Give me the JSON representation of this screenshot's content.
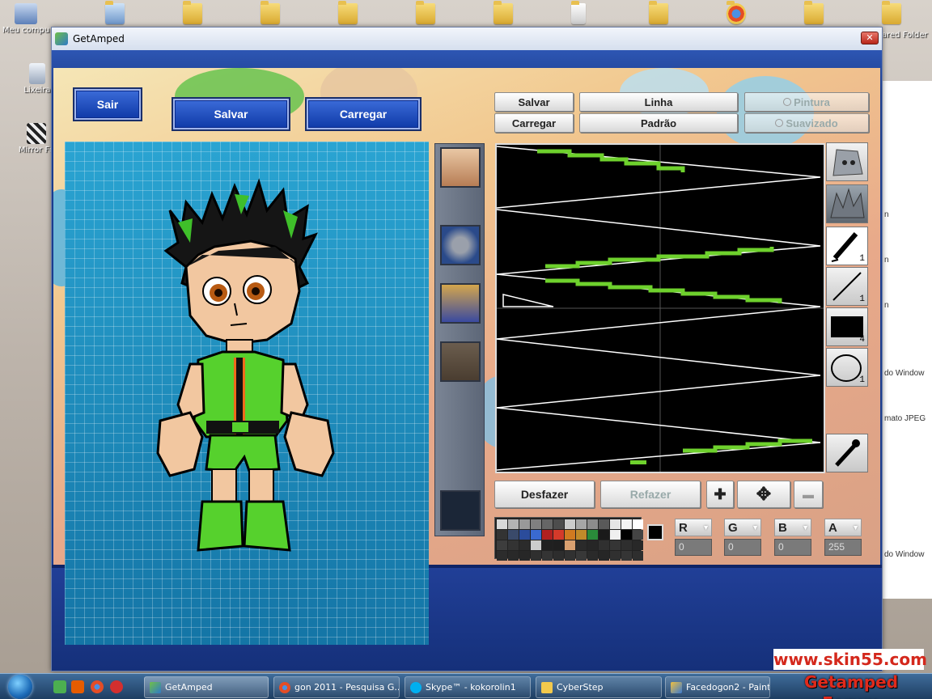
{
  "desktop": {
    "icons": [
      {
        "label": "Meu compu"
      },
      {
        "label": "Lixeira"
      },
      {
        "label": "Mirror Fo"
      }
    ],
    "right_label": "ared Folder"
  },
  "background_window": {
    "lines": [
      "n",
      "n",
      "n",
      "do Window",
      "mato JPEG",
      "do Window"
    ]
  },
  "window": {
    "title": "GetAmped",
    "close_glyph": "✕"
  },
  "menu": {
    "exit_label": "Sair",
    "save_label": "Salvar",
    "load_label": "Carregar"
  },
  "editor": {
    "save_label": "Salvar",
    "load_label": "Carregar",
    "line_label": "Linha",
    "default_label": "Padrão",
    "paint_label": "Pintura",
    "smooth_label": "Suavizado",
    "undo_label": "Desfazer",
    "redo_label": "Refazer"
  },
  "tools": [
    {
      "icon": "skull-icon",
      "count": ""
    },
    {
      "icon": "spiky-hair-icon",
      "count": ""
    },
    {
      "icon": "pen-icon",
      "count": "1"
    },
    {
      "icon": "line-icon",
      "count": "1"
    },
    {
      "icon": "rectangle-icon",
      "count": "4"
    },
    {
      "icon": "ellipse-icon",
      "count": "1"
    },
    {
      "icon": "eyedropper-icon",
      "count": ""
    }
  ],
  "palette": [
    "#d9d9d9",
    "#b3b3b3",
    "#999999",
    "#808080",
    "#666666",
    "#4d4d4d",
    "#cccccc",
    "#a6a6a6",
    "#8c8c8c",
    "#595959",
    "#e6e6e6",
    "#f2f2f2",
    "#ffffff",
    "#333333",
    "#3a4a6a",
    "#2b4c9b",
    "#3a6ad0",
    "#b02020",
    "#d43a2a",
    "#d07a20",
    "#c08a2a",
    "#2a8a3a",
    "#1a1a1a",
    "#f0f0f0",
    "#000000",
    "#444444",
    "#3d3d3d",
    "#333333",
    "#2b2b2b",
    "#cccccc",
    "#202020",
    "#1f1f1f",
    "#d9a070",
    "#2a2a2a",
    "#262626",
    "#303030",
    "#353535",
    "#2e2e2e",
    "#282828",
    "#2c2c2c",
    "#292929",
    "#272727",
    "#2f2f2f",
    "#343434",
    "#2d2d2d",
    "#313131",
    "#383838",
    "#2a2a2a",
    "#262626",
    "#303030",
    "#353535",
    "#2e2e2e"
  ],
  "selected_color": "#000000",
  "rgba": {
    "r_label": "R",
    "r": "0",
    "g_label": "G",
    "g": "0",
    "b_label": "B",
    "b": "0",
    "a_label": "A",
    "a": "255"
  },
  "taskbar": {
    "items": [
      {
        "label": "GetAmped",
        "color": "#6fbf49"
      },
      {
        "label": "gon 2011 - Pesquisa G...",
        "color": "#e44d26"
      },
      {
        "label": "Skype™ - kokorolin1",
        "color": "#00aff0"
      },
      {
        "label": "CyberStep",
        "color": "#f2c94c"
      },
      {
        "label": "Facedogon2 - Paint",
        "color": "#c0c0c0"
      }
    ]
  },
  "watermark": {
    "url": "www.skin55.com",
    "forum": "Getamped Forum"
  }
}
